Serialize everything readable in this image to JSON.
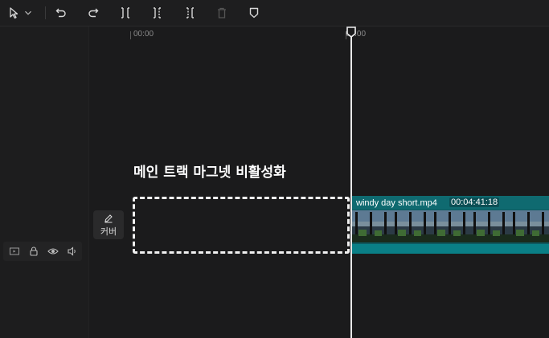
{
  "toolbar": {
    "icons": [
      "select-cursor-icon",
      "dropdown-chevron-icon",
      "undo-icon",
      "redo-icon",
      "split-icon",
      "split-left-icon",
      "split-right-icon",
      "delete-icon",
      "marker-icon"
    ]
  },
  "ruler": {
    "start_label": "00:00",
    "playhead_label": "00:00"
  },
  "track": {
    "controls": [
      "video-track-icon",
      "lock-icon",
      "visibility-eye-icon",
      "audio-volume-icon"
    ],
    "cover_label": "커버"
  },
  "main": {
    "hint": "메인 트랙 마그넷 비활성화"
  },
  "clip": {
    "name": "windy day short.mp4",
    "duration": "00:04:41:18"
  },
  "colors": {
    "background": "#1b1b1c",
    "clip": "#0e5a60",
    "clip_header": "#0f6a70",
    "playhead": "#e8e8e8"
  }
}
